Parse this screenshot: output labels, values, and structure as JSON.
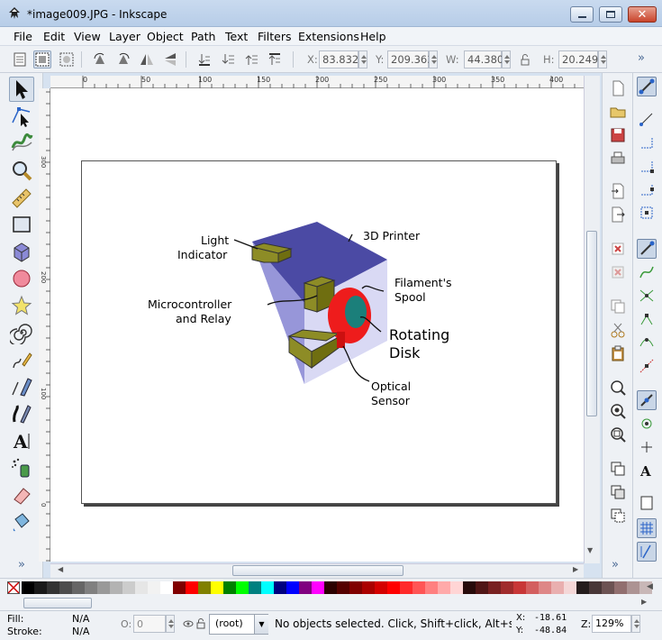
{
  "window": {
    "title": "*image009.JPG - Inkscape",
    "minimize_icon": "minimize-icon",
    "maximize_icon": "maximize-icon",
    "close_icon": "close-icon"
  },
  "menu": {
    "items": [
      "File",
      "Edit",
      "View",
      "Layer",
      "Object",
      "Path",
      "Text",
      "Filters",
      "Extensions",
      "Help"
    ]
  },
  "controls": {
    "x_label": "X:",
    "x_value": "83.832",
    "y_label": "Y:",
    "y_value": "209.363",
    "w_label": "W:",
    "w_value": "44.380",
    "h_label": "H:",
    "h_value": "20.249",
    "overflow": "»"
  },
  "ruler": {
    "top_ticks": [
      "0",
      "50",
      "100",
      "150",
      "200",
      "250",
      "300",
      "350",
      "400"
    ],
    "left_ticks": [
      "300",
      "200",
      "100",
      "0"
    ]
  },
  "diagram": {
    "light_indicator": [
      "Light",
      "Indicator"
    ],
    "printer": "3D Printer",
    "spool": [
      "Filament's",
      "Spool"
    ],
    "mcu": [
      "Microcontroller",
      "and Relay"
    ],
    "disk": [
      "Rotating",
      "Disk"
    ],
    "sensor": [
      "Optical",
      "Sensor"
    ]
  },
  "toolbox": {
    "overflow": "»"
  },
  "commands": {
    "overflow": "»"
  },
  "palette": {
    "colors": [
      "#000000",
      "#1a1a1a",
      "#333333",
      "#4d4d4d",
      "#666666",
      "#808080",
      "#999999",
      "#b3b3b3",
      "#cccccc",
      "#e6e6e6",
      "#f2f2f2",
      "#ffffff",
      "#800000",
      "#ff0000",
      "#808000",
      "#ffff00",
      "#008000",
      "#00ff00",
      "#008080",
      "#00ffff",
      "#000080",
      "#0000ff",
      "#800080",
      "#ff00ff",
      "#2b0000",
      "#550000",
      "#800000",
      "#aa0000",
      "#d40000",
      "#ff0000",
      "#ff2a2a",
      "#ff5555",
      "#ff8080",
      "#ffaaaa",
      "#ffd5d5",
      "#280b0b",
      "#501616",
      "#782121",
      "#a02c2c",
      "#c83737",
      "#d35f5f",
      "#de8787",
      "#e9afaf",
      "#f4d7d7",
      "#241c1c",
      "#483737",
      "#6c5353",
      "#916f6f",
      "#ac9393",
      "#c8b7b7"
    ]
  },
  "status": {
    "fill_label": "Fill:",
    "fill_value": "N/A",
    "stroke_label": "Stroke:",
    "stroke_value": "N/A",
    "opacity_label": "O:",
    "opacity_value": "0",
    "layer": "(root)",
    "message": "No objects selected. Click, Shift+click, Alt+scroll m",
    "x_label": "X:",
    "x_value": "-18.61",
    "y_label": "Y:",
    "y_value": "-48.84",
    "zoom_label": "Z:",
    "zoom_value": "129%"
  }
}
